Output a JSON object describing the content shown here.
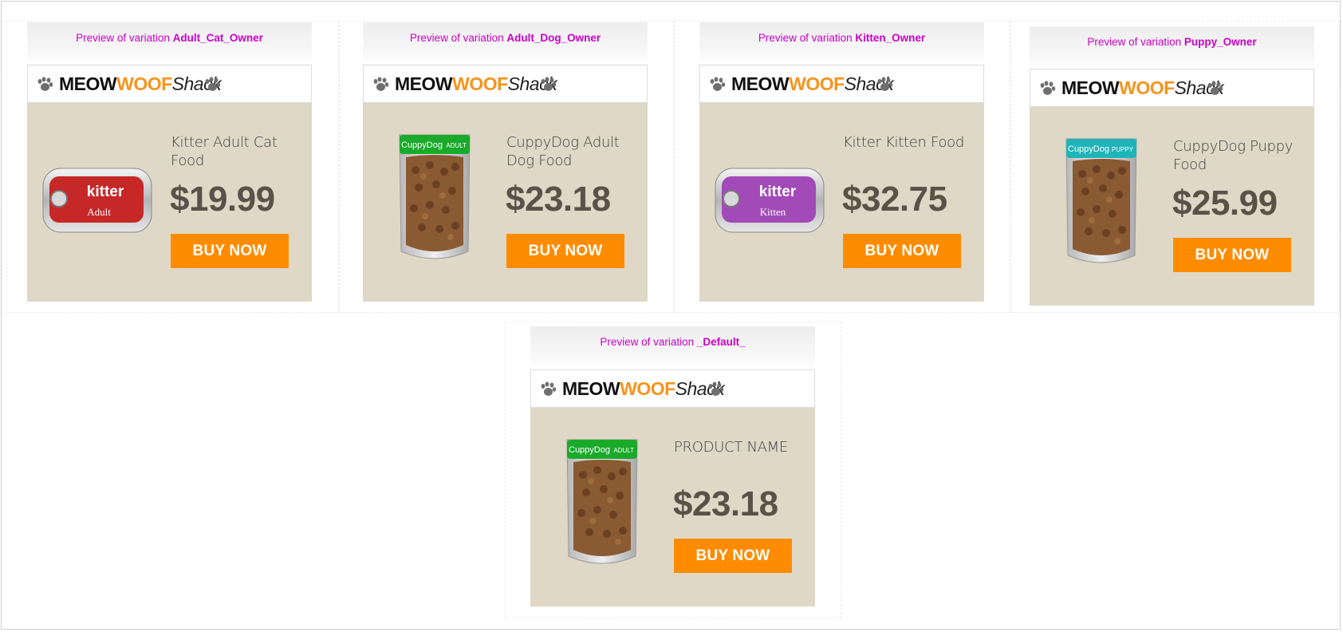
{
  "preview_prefix": "Preview of variation",
  "brand": {
    "meow": "MEOW",
    "woof": "WOOF",
    "shack": "Shack"
  },
  "colors": {
    "brand_orange": "#f7941d",
    "button": "#ff8c00",
    "card_bg": "#dfd8c6",
    "preview_text": "#cc00cc",
    "price": "#5a5248"
  },
  "cards": [
    {
      "variation": "Adult_Cat_Owner",
      "product_name": "Kitter Adult Cat Food",
      "price": "$19.99",
      "button": "BUY NOW",
      "image": {
        "type": "can-icon",
        "brand": "kitter",
        "label": "Adult",
        "color": "#c62828"
      }
    },
    {
      "variation": "Adult_Dog_Owner",
      "product_name": "CuppyDog Adult Dog Food",
      "price": "$23.18",
      "button": "BUY NOW",
      "image": {
        "type": "bag-icon",
        "brand": "CuppyDog",
        "label": "ADULT",
        "color": "#1aaa2a"
      }
    },
    {
      "variation": "Kitten_Owner",
      "product_name": "Kitter Kitten Food",
      "price": "$32.75",
      "button": "BUY NOW",
      "image": {
        "type": "can-icon",
        "brand": "kitter",
        "label": "Kitten",
        "color": "#a24bb8"
      }
    },
    {
      "variation": "Puppy_Owner",
      "product_name": "CuppyDog Puppy Food",
      "price": "$25.99",
      "button": "BUY NOW",
      "image": {
        "type": "bag-icon",
        "brand": "CuppyDog",
        "label": "PUPPY",
        "color": "#1fb4b8"
      }
    },
    {
      "variation": "_Default_",
      "product_name": "PRODUCT NAME",
      "price": "$23.18",
      "button": "BUY NOW",
      "image": {
        "type": "bag-icon",
        "brand": "CuppyDog",
        "label": "ADULT",
        "color": "#1aaa2a"
      }
    }
  ]
}
